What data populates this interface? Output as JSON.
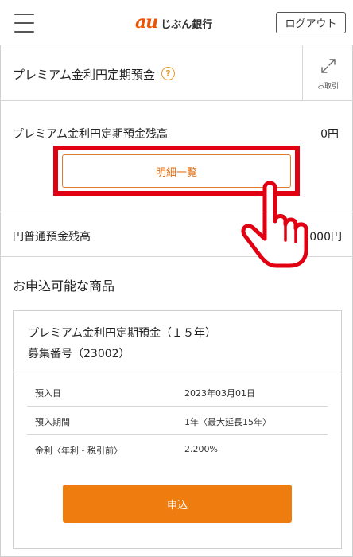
{
  "header": {
    "logo_mark": "au",
    "logo_name": "じぶん銀行",
    "logout_label": "ログアウト"
  },
  "product": {
    "title": "プレミアム金利円定期預金",
    "help_icon_text": "?",
    "transfer_label": "お取引"
  },
  "balance": {
    "label": "プレミアム金利円定期預金残高",
    "value": "0円",
    "detail_button_label": "明細一覧"
  },
  "yen_balance": {
    "label": "円普通預金残高",
    "value": "000円"
  },
  "offers": {
    "heading": "お申込可能な商品",
    "card": {
      "title": "プレミアム金利円定期預金（１５年）",
      "subtitle": "募集番号（23002）",
      "rows": [
        {
          "label": "預入日",
          "value": "2023年03月01日"
        },
        {
          "label": "預入期間",
          "value": "1年〈最大延長15年〉"
        },
        {
          "label": "金利〈年利・税引前〉",
          "value": "2.200%"
        }
      ],
      "apply_label": "申込"
    }
  },
  "colors": {
    "accent_orange": "#ee7c0e",
    "highlight_red": "#e10012",
    "logo_orange": "#eb5505"
  }
}
